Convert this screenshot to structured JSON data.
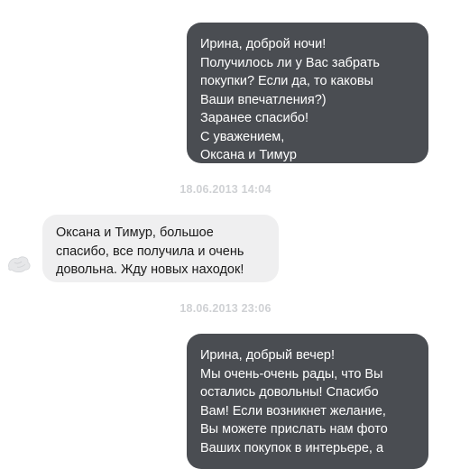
{
  "messages": [
    {
      "direction": "outgoing",
      "lines": [
        "Ирина, доброй ночи!",
        "Получилось ли у Вас забрать",
        "покупки? Если да, то каковы",
        "Ваши впечатления?)",
        "Заранее спасибо!",
        "С уважением,",
        "Оксана и Тимур"
      ]
    },
    {
      "direction": "incoming",
      "timestamp": "18.06.2013 14:04",
      "lines": [
        "Оксана и Тимур, большое",
        "спасибо, все получила и очень",
        "довольна. Жду новых находок!"
      ]
    },
    {
      "direction": "outgoing",
      "timestamp": "18.06.2013 23:06",
      "lines": [
        "Ирина, добрый вечер!",
        "Мы очень-очень рады, что Вы",
        "остались довольны! Спасибо",
        "Вам! Если возникнет желание,",
        "Вы можете прислать нам фото",
        "Ваших покупок в интерьере, а"
      ]
    }
  ],
  "avatar": {
    "icon": "cloth-avatar-icon"
  },
  "colors": {
    "outgoing_bubble": "#4a4d52",
    "incoming_bubble": "#efeff0",
    "timestamp": "#cfd1d4"
  }
}
